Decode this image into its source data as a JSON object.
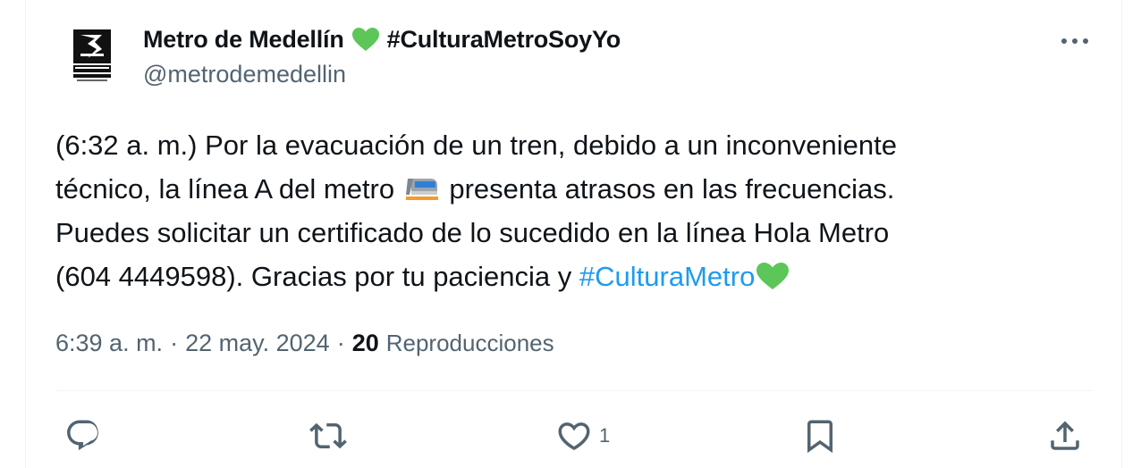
{
  "author": {
    "display_name": "Metro de Medellín",
    "name_tag": "#CulturaMetroSoyYo",
    "handle": "@metrodemedellin",
    "avatar_icon": "metro-medellin-logo-icon"
  },
  "tweet": {
    "line1": "(6:32 a. m.) Por la evacuación de un tren, debido a un inconveniente",
    "line2_before": "técnico, la línea A del metro ",
    "line2_after": " presenta atrasos en las frecuencias.",
    "line3": "Puedes solicitar un certificado de lo sucedido en la línea Hola Metro",
    "line4": "(604 4449598). Gracias por tu paciencia y ",
    "hashtag": "#CulturaMetro",
    "emoji_train": "train-icon",
    "emoji_heart": "green-heart-icon"
  },
  "meta": {
    "time": "6:39 a. m.",
    "separator": "·",
    "date": "22 may. 2024",
    "views_count": "20",
    "views_label": "Reproducciones"
  },
  "actions": {
    "reply_count": "",
    "retweet_count": "",
    "like_count": "1",
    "bookmark_count": "",
    "share_count": ""
  },
  "colors": {
    "text": "#0f1419",
    "secondary": "#536471",
    "link": "#1d9bf0",
    "heart_green": "#5cc659",
    "divider": "#eff3f4"
  }
}
